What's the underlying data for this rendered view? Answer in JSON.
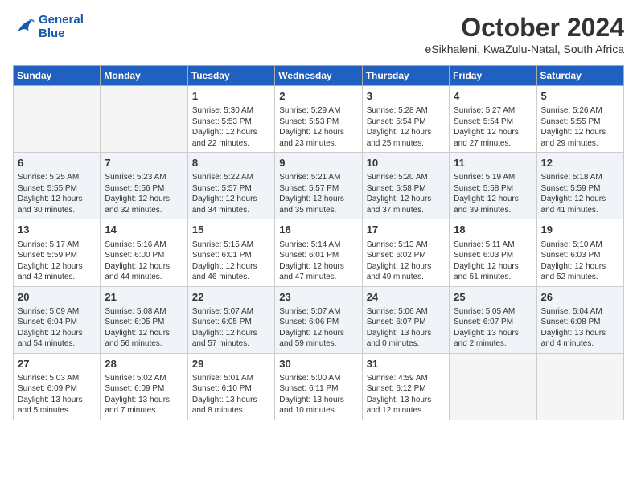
{
  "header": {
    "logo": {
      "line1": "General",
      "line2": "Blue"
    },
    "title": "October 2024",
    "subtitle": "eSikhaleni, KwaZulu-Natal, South Africa"
  },
  "weekdays": [
    "Sunday",
    "Monday",
    "Tuesday",
    "Wednesday",
    "Thursday",
    "Friday",
    "Saturday"
  ],
  "weeks": [
    [
      {
        "day": "",
        "info": ""
      },
      {
        "day": "",
        "info": ""
      },
      {
        "day": "1",
        "info": "Sunrise: 5:30 AM\nSunset: 5:53 PM\nDaylight: 12 hours\nand 22 minutes."
      },
      {
        "day": "2",
        "info": "Sunrise: 5:29 AM\nSunset: 5:53 PM\nDaylight: 12 hours\nand 23 minutes."
      },
      {
        "day": "3",
        "info": "Sunrise: 5:28 AM\nSunset: 5:54 PM\nDaylight: 12 hours\nand 25 minutes."
      },
      {
        "day": "4",
        "info": "Sunrise: 5:27 AM\nSunset: 5:54 PM\nDaylight: 12 hours\nand 27 minutes."
      },
      {
        "day": "5",
        "info": "Sunrise: 5:26 AM\nSunset: 5:55 PM\nDaylight: 12 hours\nand 29 minutes."
      }
    ],
    [
      {
        "day": "6",
        "info": "Sunrise: 5:25 AM\nSunset: 5:55 PM\nDaylight: 12 hours\nand 30 minutes."
      },
      {
        "day": "7",
        "info": "Sunrise: 5:23 AM\nSunset: 5:56 PM\nDaylight: 12 hours\nand 32 minutes."
      },
      {
        "day": "8",
        "info": "Sunrise: 5:22 AM\nSunset: 5:57 PM\nDaylight: 12 hours\nand 34 minutes."
      },
      {
        "day": "9",
        "info": "Sunrise: 5:21 AM\nSunset: 5:57 PM\nDaylight: 12 hours\nand 35 minutes."
      },
      {
        "day": "10",
        "info": "Sunrise: 5:20 AM\nSunset: 5:58 PM\nDaylight: 12 hours\nand 37 minutes."
      },
      {
        "day": "11",
        "info": "Sunrise: 5:19 AM\nSunset: 5:58 PM\nDaylight: 12 hours\nand 39 minutes."
      },
      {
        "day": "12",
        "info": "Sunrise: 5:18 AM\nSunset: 5:59 PM\nDaylight: 12 hours\nand 41 minutes."
      }
    ],
    [
      {
        "day": "13",
        "info": "Sunrise: 5:17 AM\nSunset: 5:59 PM\nDaylight: 12 hours\nand 42 minutes."
      },
      {
        "day": "14",
        "info": "Sunrise: 5:16 AM\nSunset: 6:00 PM\nDaylight: 12 hours\nand 44 minutes."
      },
      {
        "day": "15",
        "info": "Sunrise: 5:15 AM\nSunset: 6:01 PM\nDaylight: 12 hours\nand 46 minutes."
      },
      {
        "day": "16",
        "info": "Sunrise: 5:14 AM\nSunset: 6:01 PM\nDaylight: 12 hours\nand 47 minutes."
      },
      {
        "day": "17",
        "info": "Sunrise: 5:13 AM\nSunset: 6:02 PM\nDaylight: 12 hours\nand 49 minutes."
      },
      {
        "day": "18",
        "info": "Sunrise: 5:11 AM\nSunset: 6:03 PM\nDaylight: 12 hours\nand 51 minutes."
      },
      {
        "day": "19",
        "info": "Sunrise: 5:10 AM\nSunset: 6:03 PM\nDaylight: 12 hours\nand 52 minutes."
      }
    ],
    [
      {
        "day": "20",
        "info": "Sunrise: 5:09 AM\nSunset: 6:04 PM\nDaylight: 12 hours\nand 54 minutes."
      },
      {
        "day": "21",
        "info": "Sunrise: 5:08 AM\nSunset: 6:05 PM\nDaylight: 12 hours\nand 56 minutes."
      },
      {
        "day": "22",
        "info": "Sunrise: 5:07 AM\nSunset: 6:05 PM\nDaylight: 12 hours\nand 57 minutes."
      },
      {
        "day": "23",
        "info": "Sunrise: 5:07 AM\nSunset: 6:06 PM\nDaylight: 12 hours\nand 59 minutes."
      },
      {
        "day": "24",
        "info": "Sunrise: 5:06 AM\nSunset: 6:07 PM\nDaylight: 13 hours\nand 0 minutes."
      },
      {
        "day": "25",
        "info": "Sunrise: 5:05 AM\nSunset: 6:07 PM\nDaylight: 13 hours\nand 2 minutes."
      },
      {
        "day": "26",
        "info": "Sunrise: 5:04 AM\nSunset: 6:08 PM\nDaylight: 13 hours\nand 4 minutes."
      }
    ],
    [
      {
        "day": "27",
        "info": "Sunrise: 5:03 AM\nSunset: 6:09 PM\nDaylight: 13 hours\nand 5 minutes."
      },
      {
        "day": "28",
        "info": "Sunrise: 5:02 AM\nSunset: 6:09 PM\nDaylight: 13 hours\nand 7 minutes."
      },
      {
        "day": "29",
        "info": "Sunrise: 5:01 AM\nSunset: 6:10 PM\nDaylight: 13 hours\nand 8 minutes."
      },
      {
        "day": "30",
        "info": "Sunrise: 5:00 AM\nSunset: 6:11 PM\nDaylight: 13 hours\nand 10 minutes."
      },
      {
        "day": "31",
        "info": "Sunrise: 4:59 AM\nSunset: 6:12 PM\nDaylight: 13 hours\nand 12 minutes."
      },
      {
        "day": "",
        "info": ""
      },
      {
        "day": "",
        "info": ""
      }
    ]
  ]
}
